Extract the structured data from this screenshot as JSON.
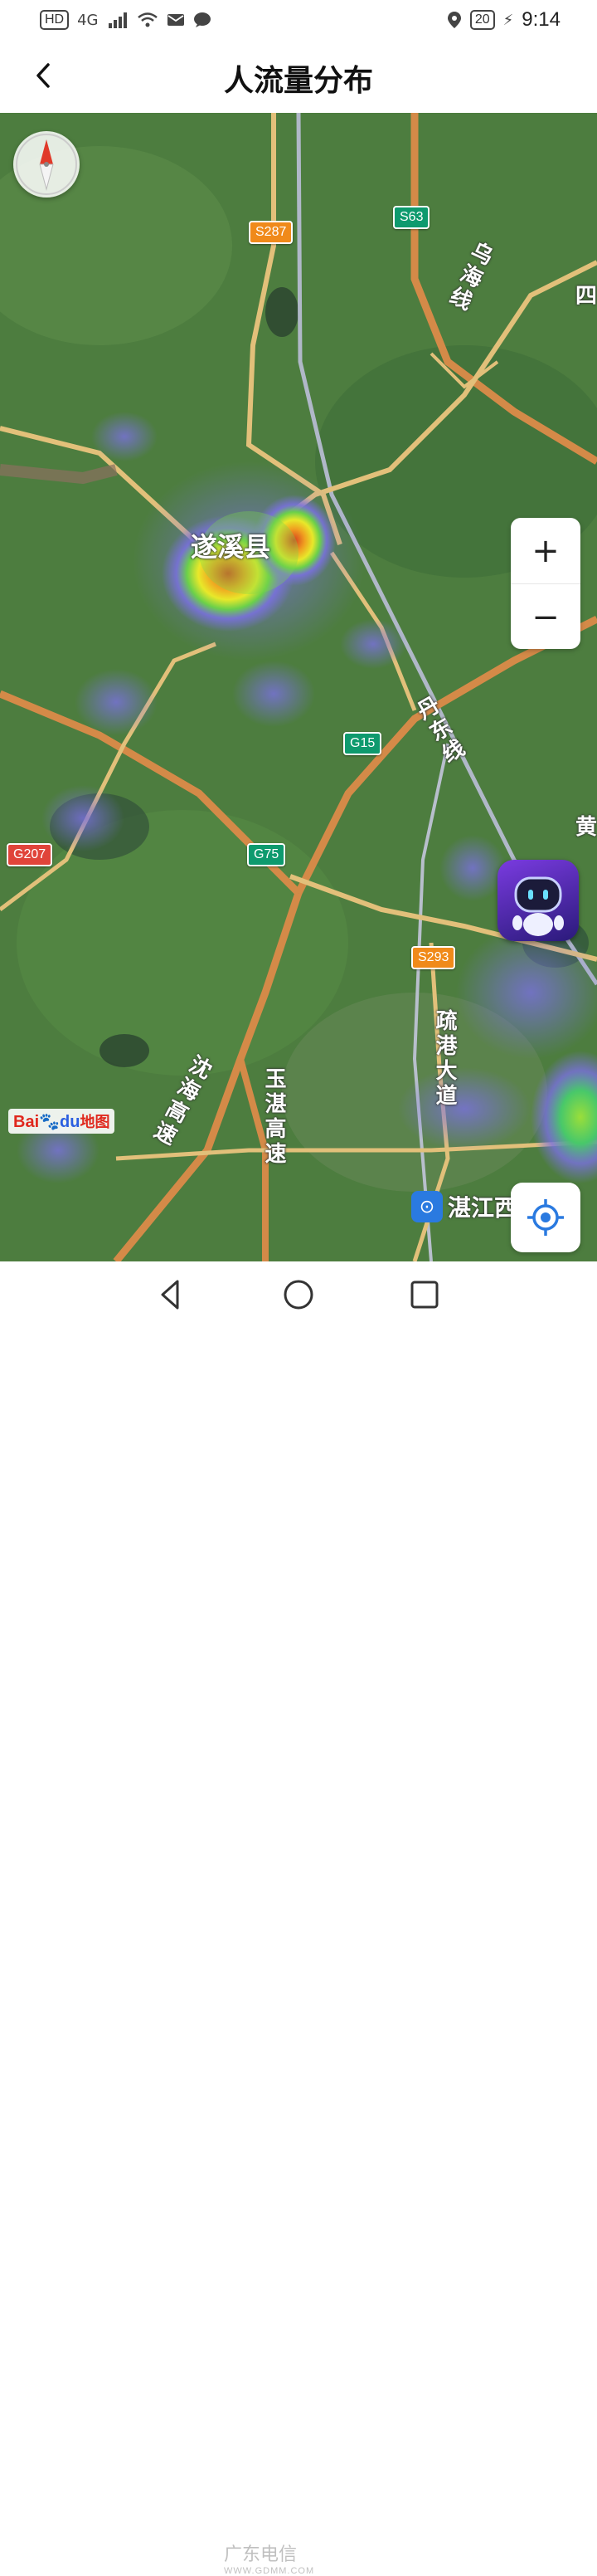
{
  "status_bar": {
    "network_badge": "HD",
    "signal_label": "4G",
    "battery": "20",
    "time": "9:14"
  },
  "header": {
    "title": "人流量分布"
  },
  "map": {
    "city_label": "遂溪县",
    "road_shields": [
      {
        "id": "S287",
        "type": "provincial"
      },
      {
        "id": "S63",
        "type": "expressway"
      },
      {
        "id": "G15",
        "type": "expressway"
      },
      {
        "id": "G75",
        "type": "expressway"
      },
      {
        "id": "G207",
        "type": "national"
      },
      {
        "id": "S293",
        "type": "provincial"
      }
    ],
    "road_names": {
      "wuhai": "乌海线",
      "dandong": "丹东线",
      "shuganggang": "疏港大道",
      "shenhai": "沈海高速",
      "yuzhan": "玉湛高速"
    },
    "edge_labels": {
      "right_top": "四",
      "right_mid": "黄"
    },
    "station_label": "湛江西",
    "logo_text": {
      "bai": "Bai",
      "du": "du",
      "ditu": "地图"
    }
  },
  "controls": {
    "zoom_in": "+",
    "zoom_out": "−"
  },
  "watermark": {
    "text": "广东电信",
    "url": "WWW.GDMM.COM"
  }
}
